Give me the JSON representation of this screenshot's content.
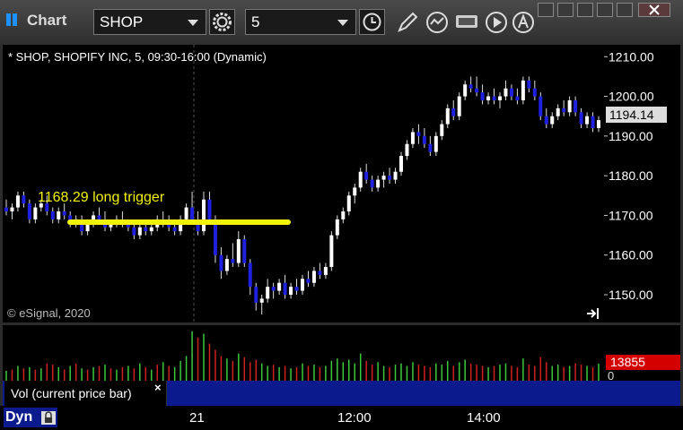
{
  "window": {
    "title": "Chart"
  },
  "toolbar": {
    "symbol": "SHOP",
    "interval": "5"
  },
  "chart": {
    "header": "* SHOP, SHOPIFY INC, 5, 09:30-16:00 (Dynamic)",
    "copyright": "© eSignal, 2020",
    "annotation": "1168.29 long trigger",
    "annotation_color": "#f2f20a",
    "up_color": "#ffffff",
    "down_color": "#2020e0",
    "last_price": "1194.14",
    "price_ticks": [
      "1210.00",
      "1200.00",
      "1190.00",
      "1180.00",
      "1170.00",
      "1160.00",
      "1150.00"
    ]
  },
  "volume": {
    "label": "Vol (current price bar)",
    "last_value": "13855",
    "zero_label": "0",
    "up_color": "#3cc83c",
    "down_color": "#d02020"
  },
  "time_axis": {
    "mode": "Dyn",
    "labels": [
      "21",
      "12:00",
      "14:00"
    ]
  },
  "chart_data": {
    "type": "candlestick",
    "symbol": "SHOP",
    "ylim": [
      1143,
      1213
    ],
    "annotation_level": 1168.29,
    "candles": [
      [
        1172,
        1174,
        1170,
        1171
      ],
      [
        1171,
        1173,
        1169,
        1172
      ],
      [
        1172,
        1176,
        1171,
        1175
      ],
      [
        1175,
        1176,
        1172,
        1173
      ],
      [
        1173,
        1174,
        1168,
        1169
      ],
      [
        1169,
        1173,
        1168,
        1172
      ],
      [
        1172,
        1174,
        1171,
        1173
      ],
      [
        1173,
        1175,
        1170,
        1171
      ],
      [
        1171,
        1172,
        1168,
        1169
      ],
      [
        1169,
        1172,
        1168,
        1171
      ],
      [
        1171,
        1173,
        1169,
        1170
      ],
      [
        1170,
        1171,
        1167,
        1168
      ],
      [
        1168,
        1170,
        1167,
        1169
      ],
      [
        1169,
        1170,
        1165,
        1166
      ],
      [
        1166,
        1169,
        1165,
        1168
      ],
      [
        1168,
        1171,
        1167,
        1170
      ],
      [
        1170,
        1172,
        1168,
        1169
      ],
      [
        1169,
        1171,
        1166,
        1167
      ],
      [
        1167,
        1169,
        1166,
        1168
      ],
      [
        1168,
        1170,
        1167,
        1169
      ],
      [
        1169,
        1171,
        1167,
        1168
      ],
      [
        1168,
        1169,
        1166,
        1167
      ],
      [
        1167,
        1168,
        1164,
        1165
      ],
      [
        1165,
        1168,
        1164,
        1167
      ],
      [
        1167,
        1169,
        1165,
        1166
      ],
      [
        1166,
        1168,
        1165,
        1167
      ],
      [
        1167,
        1170,
        1166,
        1169
      ],
      [
        1169,
        1171,
        1167,
        1168
      ],
      [
        1168,
        1170,
        1166,
        1167
      ],
      [
        1167,
        1169,
        1165,
        1166
      ],
      [
        1166,
        1170,
        1165,
        1169
      ],
      [
        1169,
        1173,
        1168,
        1172
      ],
      [
        1172,
        1176,
        1168,
        1169
      ],
      [
        1169,
        1171,
        1165,
        1166
      ],
      [
        1166,
        1176,
        1165,
        1174
      ],
      [
        1174,
        1176,
        1168,
        1169
      ],
      [
        1169,
        1170,
        1158,
        1160
      ],
      [
        1160,
        1162,
        1154,
        1156
      ],
      [
        1156,
        1160,
        1155,
        1159
      ],
      [
        1159,
        1163,
        1157,
        1158
      ],
      [
        1158,
        1166,
        1157,
        1164
      ],
      [
        1164,
        1165,
        1157,
        1158
      ],
      [
        1158,
        1159,
        1150,
        1152
      ],
      [
        1152,
        1153,
        1146,
        1148
      ],
      [
        1148,
        1150,
        1145,
        1149
      ],
      [
        1149,
        1154,
        1148,
        1152
      ],
      [
        1152,
        1153,
        1149,
        1151
      ],
      [
        1151,
        1154,
        1150,
        1153
      ],
      [
        1153,
        1155,
        1149,
        1150
      ],
      [
        1150,
        1153,
        1149,
        1152
      ],
      [
        1152,
        1154,
        1150,
        1151
      ],
      [
        1151,
        1155,
        1150,
        1154
      ],
      [
        1154,
        1156,
        1152,
        1153
      ],
      [
        1153,
        1157,
        1152,
        1156
      ],
      [
        1156,
        1158,
        1154,
        1155
      ],
      [
        1155,
        1158,
        1154,
        1157
      ],
      [
        1157,
        1166,
        1156,
        1165
      ],
      [
        1165,
        1170,
        1164,
        1169
      ],
      [
        1169,
        1172,
        1168,
        1171
      ],
      [
        1171,
        1176,
        1170,
        1175
      ],
      [
        1175,
        1178,
        1173,
        1177
      ],
      [
        1177,
        1182,
        1176,
        1181
      ],
      [
        1181,
        1183,
        1178,
        1179
      ],
      [
        1179,
        1180,
        1176,
        1177
      ],
      [
        1177,
        1180,
        1176,
        1179
      ],
      [
        1179,
        1181,
        1177,
        1180
      ],
      [
        1180,
        1182,
        1178,
        1179
      ],
      [
        1179,
        1182,
        1178,
        1181
      ],
      [
        1181,
        1186,
        1180,
        1185
      ],
      [
        1185,
        1189,
        1184,
        1188
      ],
      [
        1188,
        1192,
        1187,
        1191
      ],
      [
        1191,
        1193,
        1188,
        1190
      ],
      [
        1190,
        1192,
        1187,
        1188
      ],
      [
        1188,
        1190,
        1185,
        1186
      ],
      [
        1186,
        1191,
        1185,
        1190
      ],
      [
        1190,
        1194,
        1189,
        1193
      ],
      [
        1193,
        1198,
        1192,
        1197
      ],
      [
        1197,
        1199,
        1194,
        1195
      ],
      [
        1195,
        1201,
        1194,
        1200
      ],
      [
        1200,
        1204,
        1199,
        1203
      ],
      [
        1203,
        1205,
        1201,
        1202
      ],
      [
        1202,
        1205,
        1200,
        1201
      ],
      [
        1201,
        1203,
        1198,
        1199
      ],
      [
        1199,
        1201,
        1198,
        1200
      ],
      [
        1200,
        1202,
        1198,
        1199
      ],
      [
        1199,
        1201,
        1197,
        1200
      ],
      [
        1200,
        1204,
        1199,
        1202
      ],
      [
        1202,
        1203,
        1199,
        1200
      ],
      [
        1200,
        1202,
        1198,
        1199
      ],
      [
        1199,
        1205,
        1198,
        1204
      ],
      [
        1204,
        1205,
        1201,
        1202
      ],
      [
        1202,
        1204,
        1199,
        1200
      ],
      [
        1200,
        1201,
        1194,
        1195
      ],
      [
        1195,
        1197,
        1192,
        1193
      ],
      [
        1193,
        1196,
        1192,
        1195
      ],
      [
        1195,
        1198,
        1194,
        1197
      ],
      [
        1197,
        1199,
        1195,
        1196
      ],
      [
        1196,
        1200,
        1195,
        1199
      ],
      [
        1199,
        1200,
        1195,
        1196
      ],
      [
        1196,
        1197,
        1192,
        1193
      ],
      [
        1193,
        1196,
        1192,
        1195
      ],
      [
        1195,
        1196,
        1191,
        1192
      ],
      [
        1192,
        1195,
        1191,
        1194
      ]
    ],
    "volume": [
      [
        8000,
        1
      ],
      [
        9000,
        0
      ],
      [
        12000,
        1
      ],
      [
        10000,
        0
      ],
      [
        11000,
        1
      ],
      [
        9000,
        0
      ],
      [
        10000,
        1
      ],
      [
        14000,
        0
      ],
      [
        13000,
        0
      ],
      [
        11000,
        1
      ],
      [
        9000,
        0
      ],
      [
        12000,
        1
      ],
      [
        14000,
        0
      ],
      [
        10000,
        1
      ],
      [
        9000,
        0
      ],
      [
        11000,
        1
      ],
      [
        12000,
        0
      ],
      [
        13000,
        1
      ],
      [
        10000,
        0
      ],
      [
        9000,
        1
      ],
      [
        11000,
        0
      ],
      [
        12000,
        1
      ],
      [
        10000,
        0
      ],
      [
        14000,
        1
      ],
      [
        11000,
        0
      ],
      [
        9000,
        1
      ],
      [
        13000,
        0
      ],
      [
        15000,
        1
      ],
      [
        12000,
        0
      ],
      [
        11000,
        1
      ],
      [
        16000,
        1
      ],
      [
        20000,
        1
      ],
      [
        40000,
        1
      ],
      [
        35000,
        0
      ],
      [
        38000,
        1
      ],
      [
        30000,
        0
      ],
      [
        25000,
        0
      ],
      [
        20000,
        0
      ],
      [
        18000,
        1
      ],
      [
        16000,
        0
      ],
      [
        22000,
        1
      ],
      [
        19000,
        0
      ],
      [
        15000,
        0
      ],
      [
        17000,
        0
      ],
      [
        14000,
        1
      ],
      [
        12000,
        1
      ],
      [
        13000,
        0
      ],
      [
        11000,
        1
      ],
      [
        12000,
        0
      ],
      [
        10000,
        1
      ],
      [
        11000,
        0
      ],
      [
        14000,
        1
      ],
      [
        12000,
        0
      ],
      [
        13000,
        1
      ],
      [
        11000,
        0
      ],
      [
        12000,
        1
      ],
      [
        16000,
        1
      ],
      [
        18000,
        1
      ],
      [
        15000,
        1
      ],
      [
        17000,
        1
      ],
      [
        14000,
        1
      ],
      [
        22000,
        1
      ],
      [
        16000,
        0
      ],
      [
        13000,
        0
      ],
      [
        15000,
        1
      ],
      [
        12000,
        1
      ],
      [
        11000,
        0
      ],
      [
        13000,
        1
      ],
      [
        14000,
        1
      ],
      [
        12000,
        1
      ],
      [
        15000,
        1
      ],
      [
        13000,
        0
      ],
      [
        12000,
        0
      ],
      [
        11000,
        0
      ],
      [
        14000,
        1
      ],
      [
        13000,
        1
      ],
      [
        16000,
        1
      ],
      [
        12000,
        0
      ],
      [
        15000,
        1
      ],
      [
        17000,
        1
      ],
      [
        14000,
        0
      ],
      [
        13000,
        0
      ],
      [
        12000,
        0
      ],
      [
        11000,
        1
      ],
      [
        12000,
        0
      ],
      [
        13000,
        1
      ],
      [
        14000,
        1
      ],
      [
        12000,
        0
      ],
      [
        11000,
        0
      ],
      [
        18000,
        1
      ],
      [
        13000,
        0
      ],
      [
        12000,
        0
      ],
      [
        19000,
        0
      ],
      [
        15000,
        0
      ],
      [
        12000,
        1
      ],
      [
        13000,
        1
      ],
      [
        11000,
        0
      ],
      [
        12000,
        1
      ],
      [
        14000,
        0
      ],
      [
        13000,
        0
      ],
      [
        12000,
        1
      ],
      [
        11000,
        0
      ],
      [
        13855,
        1
      ]
    ]
  }
}
